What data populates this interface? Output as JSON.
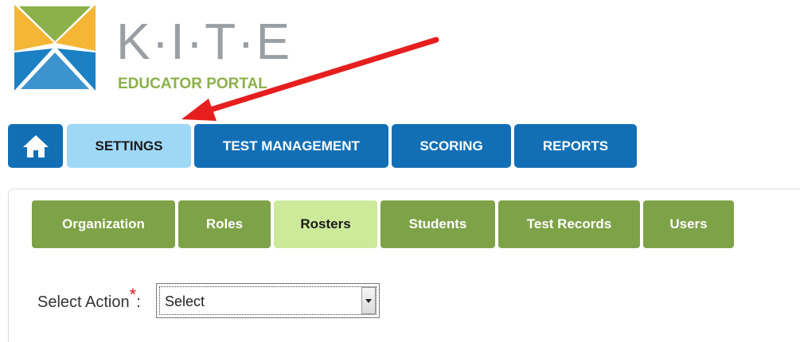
{
  "logo": {
    "wordmark": "K·I·T·E",
    "trademark": "™",
    "subtitle": "EDUCATOR PORTAL",
    "colors": {
      "yellow": "#f4b634",
      "green": "#8cb04a",
      "blue": "#1b80c4",
      "gray": "#9a9fa3"
    }
  },
  "top_nav": {
    "home_icon": "home-icon",
    "items": [
      {
        "label": "SETTINGS",
        "active": true
      },
      {
        "label": "TEST MANAGEMENT",
        "active": false
      },
      {
        "label": "SCORING",
        "active": false
      },
      {
        "label": "REPORTS",
        "active": false
      }
    ],
    "colors": {
      "active": "#9fd8f7",
      "inactive": "#126fb5"
    }
  },
  "sub_nav": {
    "items": [
      {
        "label": "Organization",
        "active": false
      },
      {
        "label": "Roles",
        "active": false
      },
      {
        "label": "Rosters",
        "active": true
      },
      {
        "label": "Students",
        "active": false
      },
      {
        "label": "Test Records",
        "active": false
      },
      {
        "label": "Users",
        "active": false
      }
    ],
    "colors": {
      "active": "#cdea9b",
      "inactive": "#7ea247"
    }
  },
  "action": {
    "label": "Select Action",
    "required_marker": "*",
    "separator": ":",
    "selected": "Select"
  },
  "annotation": {
    "arrow_color": "#e61e1e"
  }
}
